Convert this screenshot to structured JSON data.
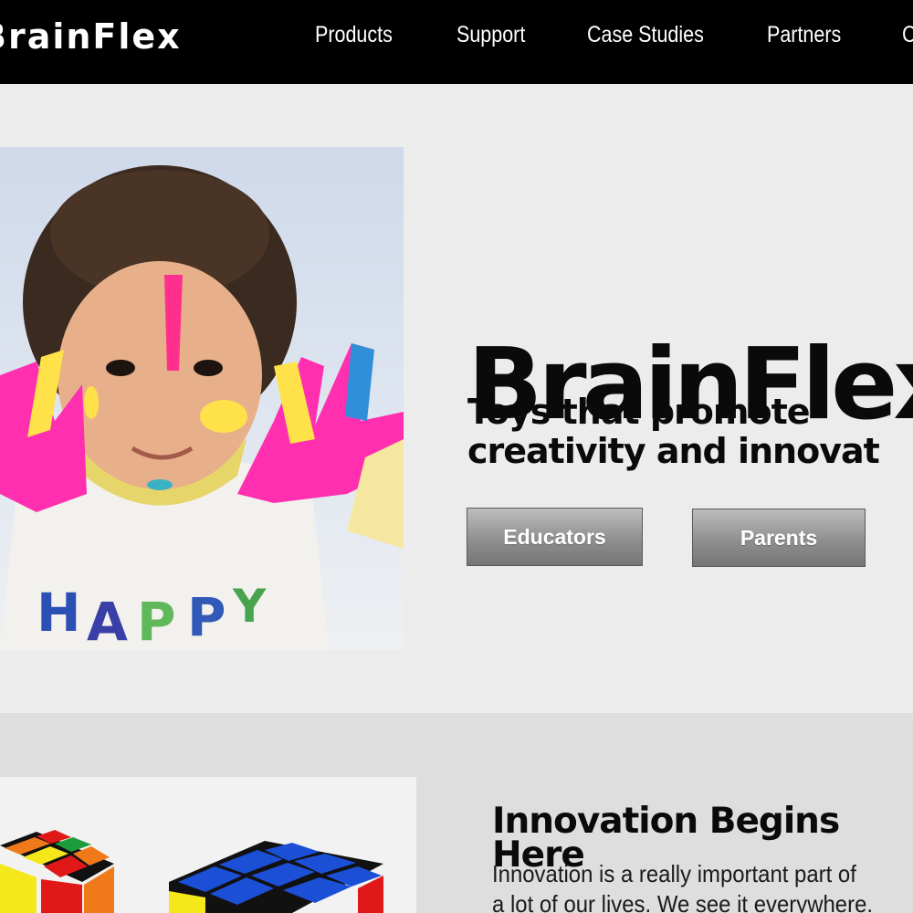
{
  "brand": {
    "visible_text": "BrainFlex"
  },
  "nav": {
    "items": [
      "Products",
      "Support",
      "Case Studies",
      "Partners",
      "C"
    ]
  },
  "hero": {
    "title": "BrainFlex",
    "subtitle_line1": "Toys that promote",
    "subtitle_line2": "creativity and innovat",
    "buttons": {
      "educators": "Educators",
      "parents": "Parents"
    }
  },
  "section2": {
    "title_line1": "Innovation Begins",
    "title_line2": "Here",
    "body_line1": "Innovation is a really important part of",
    "body_line2": "a lot of our lives. We see it everywhere."
  },
  "colors": {
    "nav_bg": "#000000",
    "page_bg": "#ececec",
    "section_bg": "#dedede",
    "button_gray": "#8f8f8f"
  }
}
